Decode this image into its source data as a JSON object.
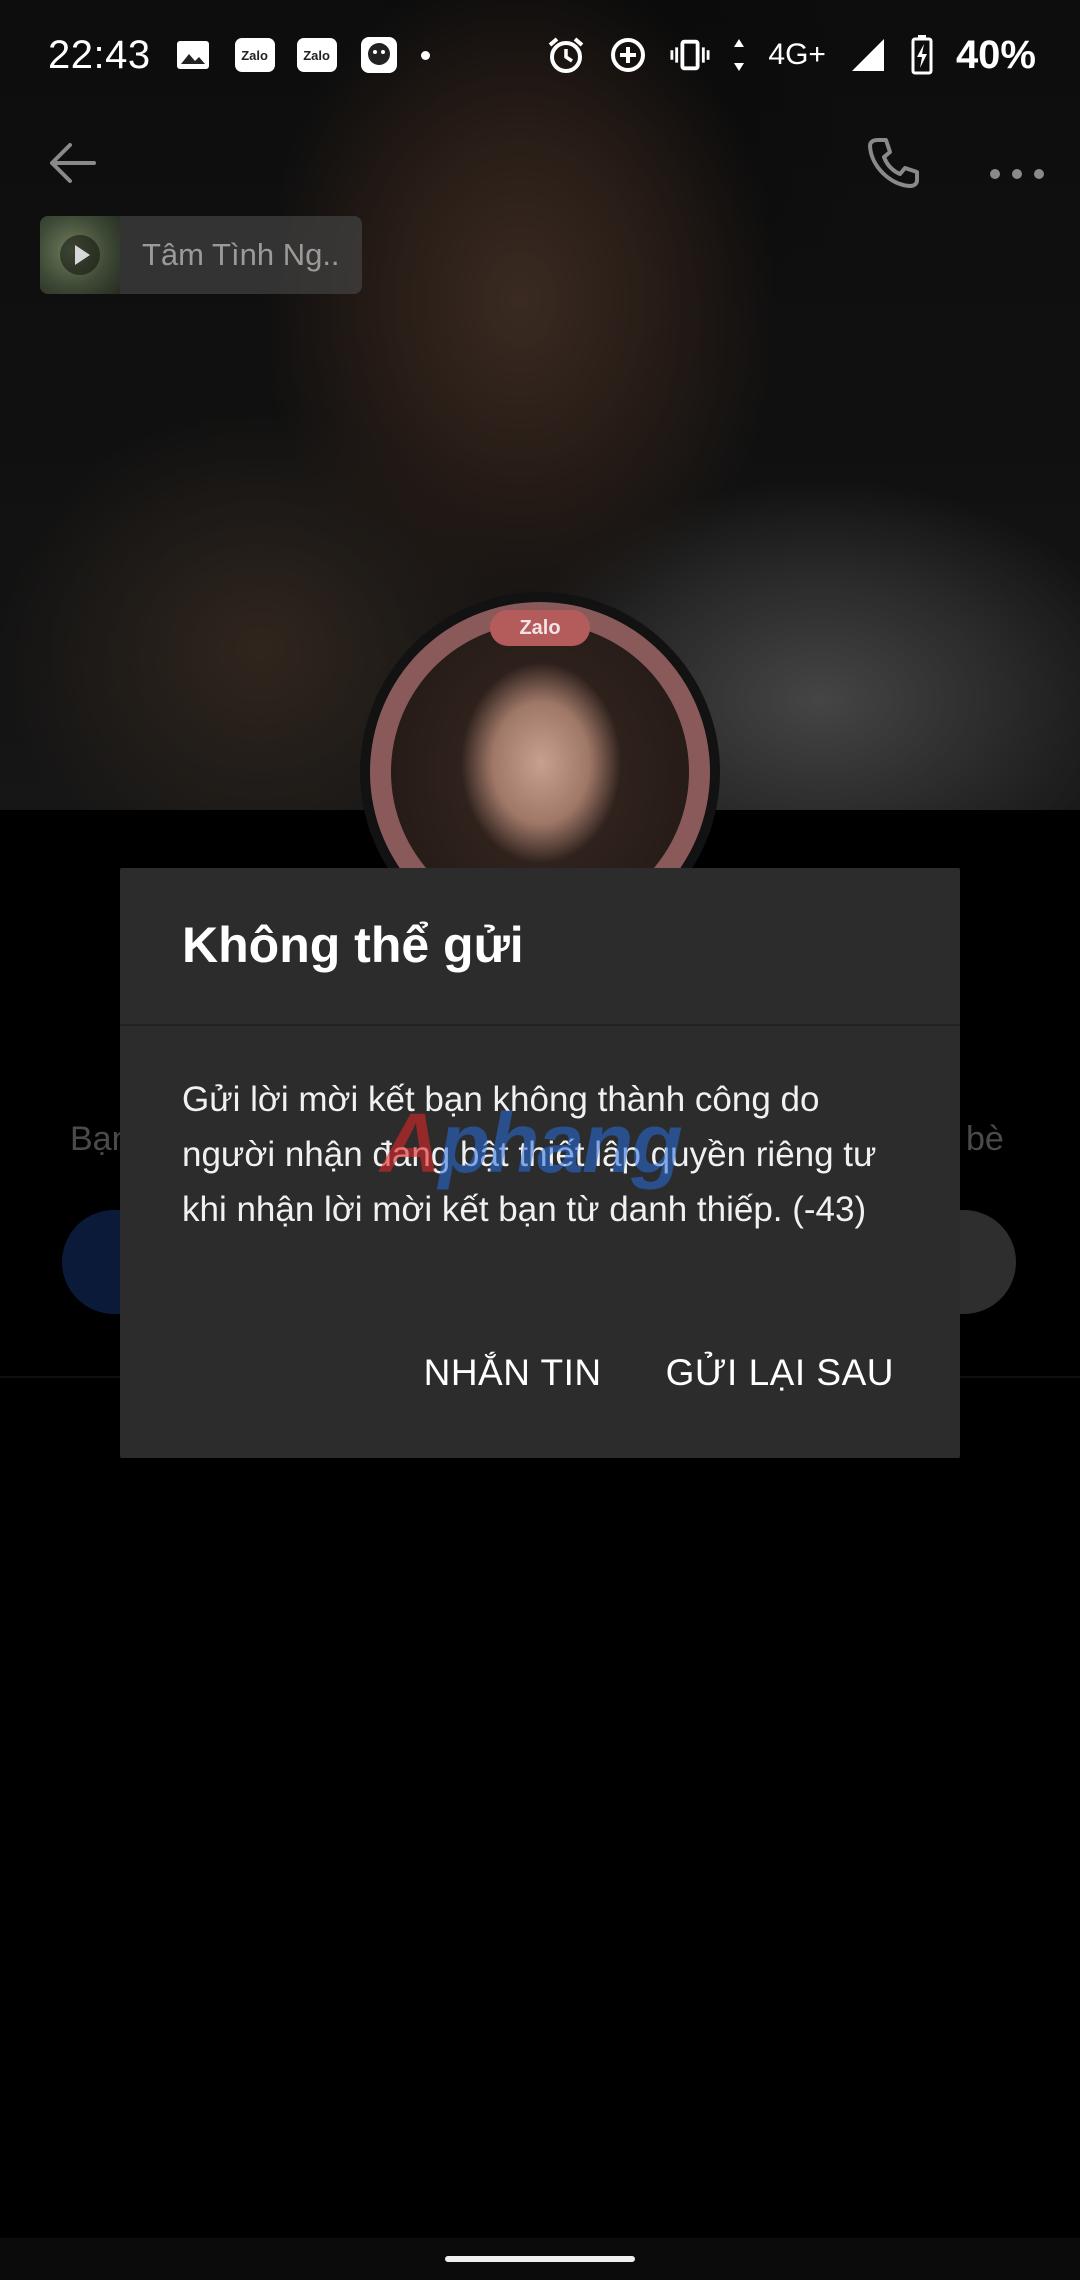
{
  "status_bar": {
    "time": "22:43",
    "notification_icons": [
      "image-icon",
      "zalo-icon",
      "zalo-icon",
      "avatar-app-icon",
      "more-dot-icon"
    ],
    "zalo_label": "Zalo",
    "system_icons": [
      "alarm-icon",
      "data-saver-icon",
      "vibrate-icon",
      "network-arrows-icon",
      "signal-icon",
      "battery-charging-icon"
    ],
    "network": "4G+",
    "battery": "40%"
  },
  "app_bar": {
    "icons": [
      "back-arrow-icon",
      "phone-icon",
      "more-dots-icon"
    ]
  },
  "music": {
    "title": "Tâm Tình Ng.."
  },
  "avatar": {
    "badge": "Zalo"
  },
  "background_profile": {
    "left_text": "Bạn",
    "right_text": "bè"
  },
  "dialog": {
    "title": "Không thể gửi",
    "message": "Gửi lời mời kết bạn không thành công do người nhận đang bật thiết lập quyền riêng tư khi nhận lời mời kết bạn từ danh thiếp. (-43)",
    "buttons": {
      "message": "NHẮN TIN",
      "resend_later": "GỬI LẠI SAU"
    }
  },
  "watermark": "Aphang",
  "colors": {
    "dialog_bg": "#2c2c2c",
    "scrim": "#000000",
    "text": "#ffffff"
  }
}
